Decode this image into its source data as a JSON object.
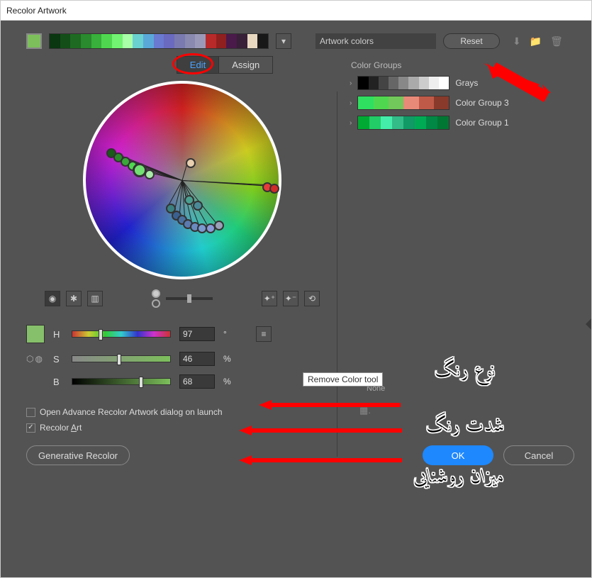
{
  "title": "Recolor Artwork",
  "preset": "Artwork colors",
  "reset": "Reset",
  "tabs": {
    "edit": "Edit",
    "assign": "Assign"
  },
  "colorgroups": {
    "heading": "Color Groups",
    "items": [
      {
        "name": "Grays",
        "colors": [
          "#000",
          "#222",
          "#444",
          "#666",
          "#888",
          "#aaa",
          "#ccc",
          "#eee",
          "#fff"
        ]
      },
      {
        "name": "Color Group 3",
        "colors": [
          "#2fe060",
          "#4fd84f",
          "#72c85a",
          "#e88a78",
          "#c05a48",
          "#8a3a2a"
        ]
      },
      {
        "name": "Color Group 1",
        "colors": [
          "#0a3",
          "#2c6",
          "#4ea",
          "#3b8",
          "#196",
          "#0a5",
          "#084",
          "#073"
        ]
      }
    ]
  },
  "hsb": {
    "h": {
      "label": "H",
      "value": "97",
      "unit": "°"
    },
    "s": {
      "label": "S",
      "value": "46",
      "unit": "%"
    },
    "b": {
      "label": "B",
      "value": "68",
      "unit": "%"
    }
  },
  "tooltip": "Remove Color tool",
  "none": "None",
  "checks": {
    "open": "Open Advance Recolor Artwork dialog on launch",
    "recolor": "Recolor Art"
  },
  "buttons": {
    "generative": "Generative Recolor",
    "ok": "OK",
    "cancel": "Cancel"
  },
  "strip_colors": [
    "#0a3610",
    "#134e18",
    "#1e6a22",
    "#2a8a2e",
    "#38b03b",
    "#4fd84f",
    "#72f372",
    "#a8ffa8",
    "#6ad0d0",
    "#5aa8d8",
    "#6a7ad0",
    "#6a6ac0",
    "#7a7ab0",
    "#8a8ab0",
    "#9a9ab8",
    "#b82a2a",
    "#901f1f",
    "#4a1a4a",
    "#382038",
    "#e8d8c0",
    "#181818"
  ],
  "annotations": {
    "type": "نوع رنگ",
    "intensity": "شدت رنگ",
    "brightness": "میزان روشنایی"
  }
}
